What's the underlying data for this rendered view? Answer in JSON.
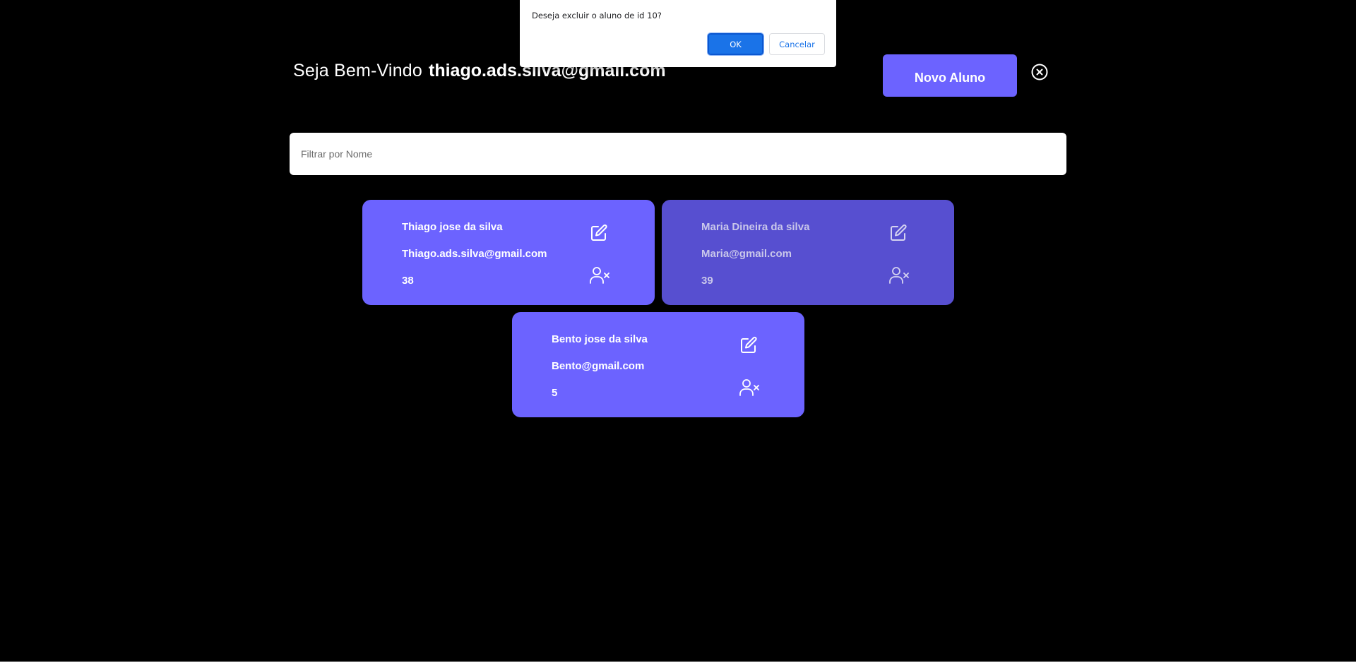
{
  "header": {
    "welcome_label": "Seja Bem-Vindo",
    "user_email": "thiago.ads.silva@gmail.com",
    "new_student_button": "Novo Aluno",
    "logout_icon": "close-circle-icon"
  },
  "filter": {
    "placeholder": "Filtrar por Nome",
    "value": ""
  },
  "students": [
    {
      "name": "Thiago jose da silva",
      "email": "Thiago.ads.silva@gmail.com",
      "age": "38",
      "edit_icon": "edit-icon",
      "delete_icon": "user-remove-icon"
    },
    {
      "name": "Maria Dineira da silva",
      "email": "Maria@gmail.com",
      "age": "39",
      "edit_icon": "edit-icon",
      "delete_icon": "user-remove-icon"
    },
    {
      "name": "Bento jose da silva",
      "email": "Bento@gmail.com",
      "age": "5",
      "edit_icon": "edit-icon",
      "delete_icon": "user-remove-icon"
    }
  ],
  "dialog": {
    "message": "Deseja excluir o aluno de id 10?",
    "ok_label": "OK",
    "cancel_label": "Cancelar"
  },
  "colors": {
    "background": "#000000",
    "accent": "#6c63ff",
    "card_dimmed": "#574fd0",
    "dialog_button": "#1a73e8"
  }
}
